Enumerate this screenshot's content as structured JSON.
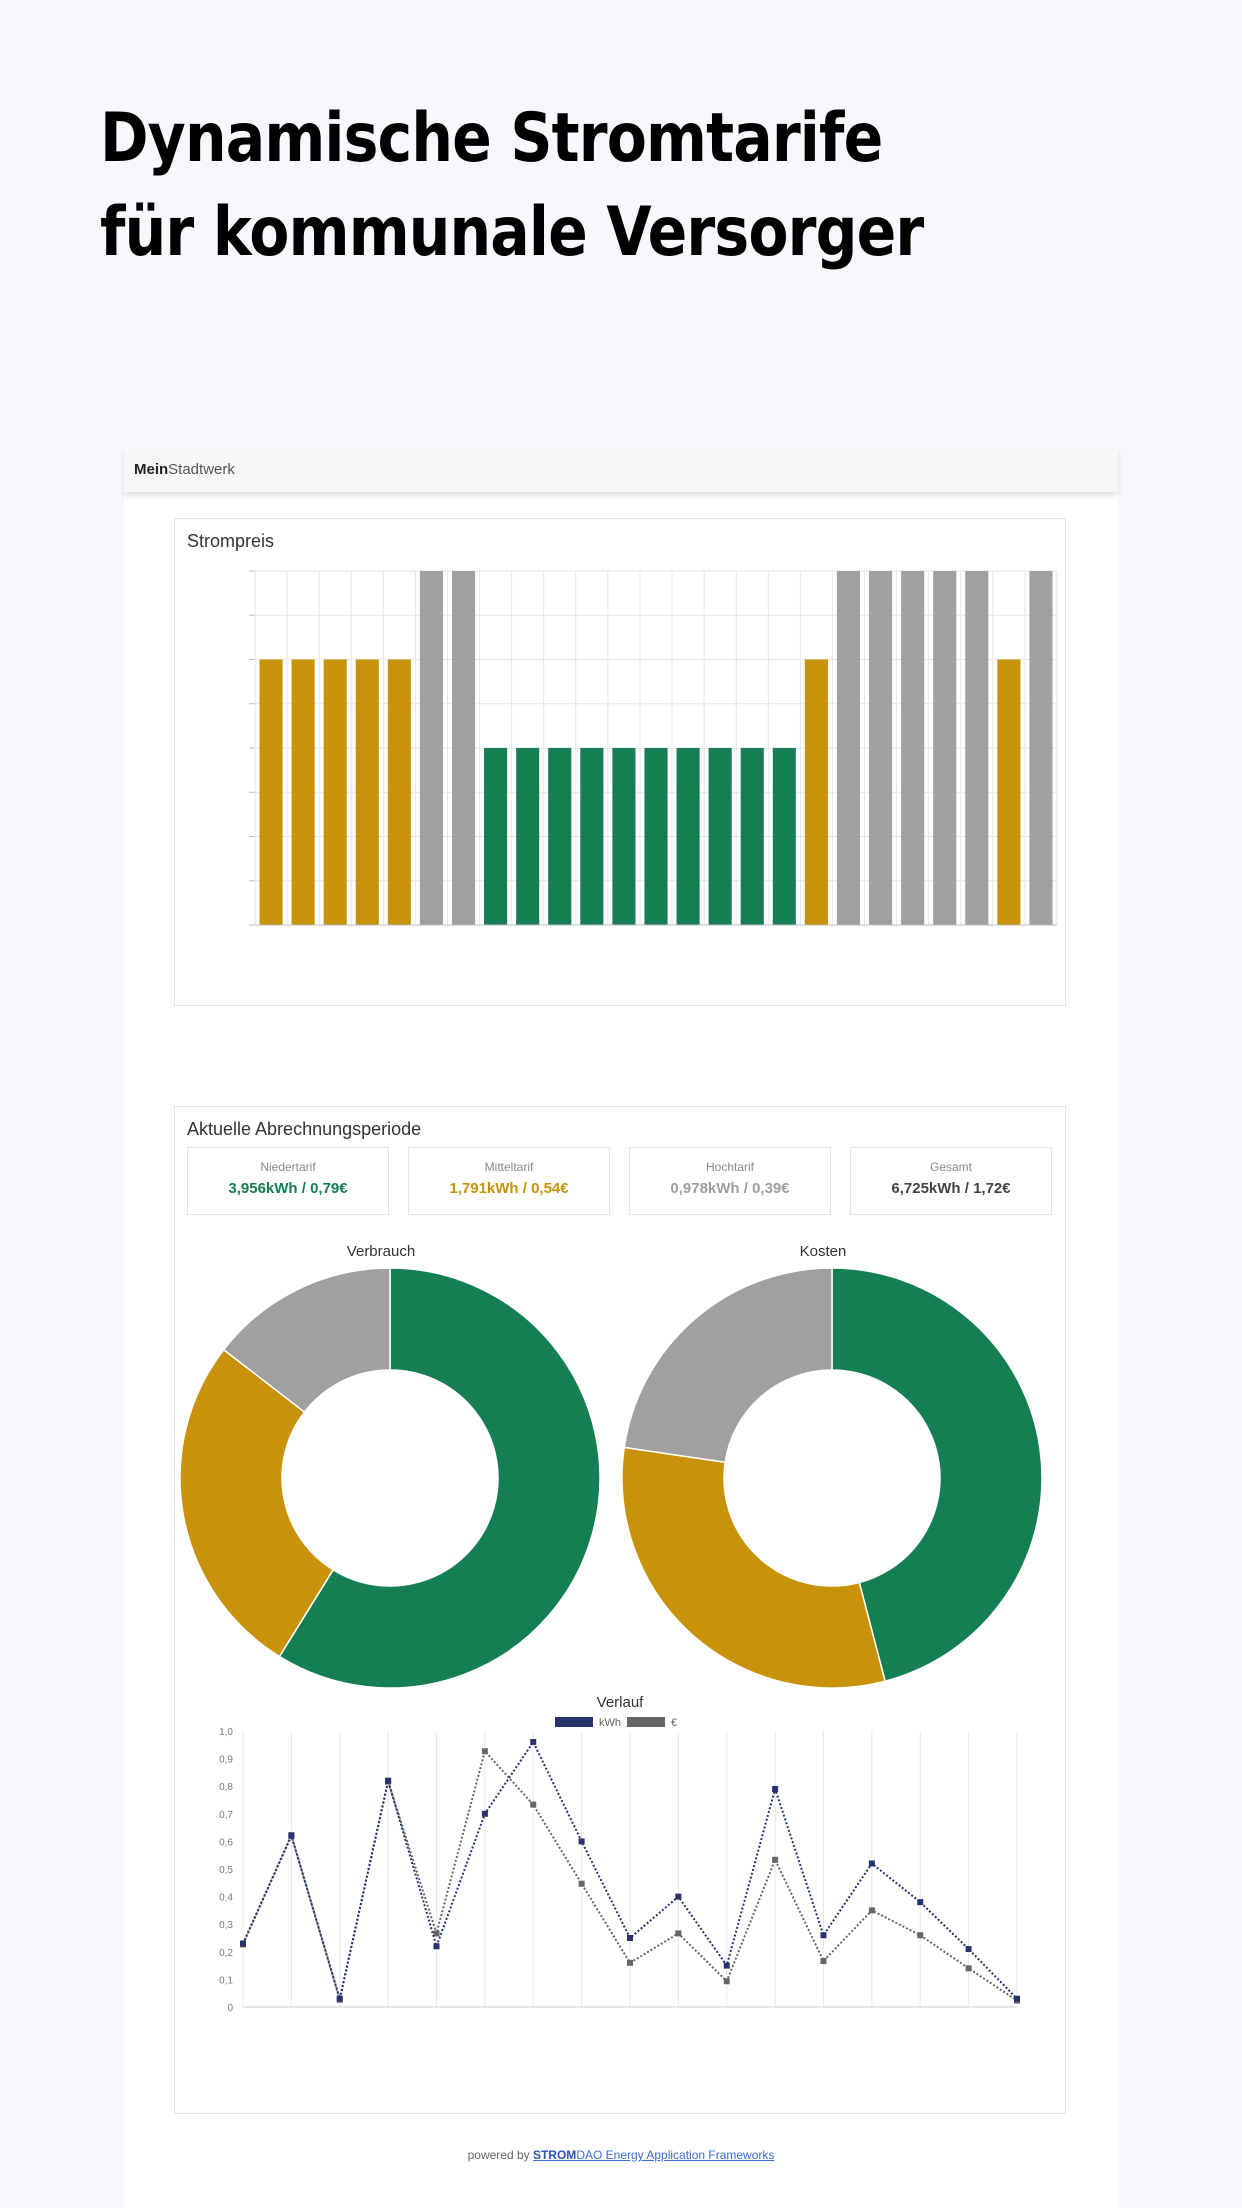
{
  "headline": "Dynamische Stromtarife für kommunale Versorger",
  "app": {
    "brand_bold": "Mein",
    "brand_rest": "Stadtwerk"
  },
  "price_card": {
    "title": "Strompreis"
  },
  "billing_card": {
    "title": "Aktuelle Abrechnungsperiode",
    "stats": [
      {
        "label": "Niedertarif",
        "value": "3,956kWh / 0,79€",
        "color": "#167e53"
      },
      {
        "label": "Mitteltarif",
        "value": "1,791kWh / 0,54€",
        "color": "#c8920a"
      },
      {
        "label": "Hochtarif",
        "value": "0,978kWh / 0,39€",
        "color": "#9e9e9e"
      },
      {
        "label": "Gesamt",
        "value": "6,725kWh / 1,72€",
        "color": "#444444"
      }
    ],
    "donut_consumption_title": "Verbrauch",
    "donut_cost_title": "Kosten",
    "line_title": "Verlauf"
  },
  "footer": {
    "prefix": "powered by ",
    "link_bold": "STROM",
    "link_rest": "DAO Energy Application Frameworks"
  },
  "colors": {
    "low": "#167e53",
    "mid": "#c8920a",
    "high": "#a0a0a0",
    "kwh_line": "#27326e",
    "cost_line": "#666666"
  },
  "chart_data": [
    {
      "type": "bar",
      "title": "Strompreis",
      "ylim": [
        0,
        0.4
      ],
      "series": [
        {
          "values": [
            0.3,
            0.3,
            0.3,
            0.3,
            0.3,
            0.4,
            0.4,
            0.2,
            0.2,
            0.2,
            0.2,
            0.2,
            0.2,
            0.2,
            0.2,
            0.2,
            0.2,
            0.3,
            0.4,
            0.4,
            0.4,
            0.4,
            0.4,
            0.3,
            0.4
          ],
          "tiers": [
            "mid",
            "mid",
            "mid",
            "mid",
            "mid",
            "high",
            "high",
            "low",
            "low",
            "low",
            "low",
            "low",
            "low",
            "low",
            "low",
            "low",
            "low",
            "mid",
            "high",
            "high",
            "high",
            "high",
            "high",
            "mid",
            "high"
          ]
        }
      ],
      "grid": true
    },
    {
      "type": "pie",
      "title": "Verbrauch",
      "categories": [
        "Niedertarif",
        "Mitteltarif",
        "Hochtarif"
      ],
      "values": [
        3.956,
        1.791,
        0.978
      ]
    },
    {
      "type": "pie",
      "title": "Kosten",
      "categories": [
        "Niedertarif",
        "Mitteltarif",
        "Hochtarif"
      ],
      "values": [
        0.79,
        0.54,
        0.39
      ]
    },
    {
      "type": "line",
      "title": "Verlauf",
      "yticks_left": [
        "0",
        "0,1",
        "0,2",
        "0,3",
        "0,4",
        "0,5",
        "0,6",
        "0,7",
        "0,8",
        "0,9",
        "1,0"
      ],
      "ylim_left": [
        0,
        1.0
      ],
      "ylim_right": [
        0,
        0.3
      ],
      "series": [
        {
          "name": "kWh",
          "axis": "left",
          "values": [
            0.23,
            0.62,
            0.03,
            0.82,
            0.22,
            0.7,
            0.96,
            0.6,
            0.25,
            0.4,
            0.15,
            0.79,
            0.26,
            0.52,
            0.38,
            0.21,
            0.03
          ]
        },
        {
          "name": "€",
          "axis": "right",
          "values": [
            0.068,
            0.187,
            0.008,
            0.245,
            0.08,
            0.278,
            0.22,
            0.134,
            0.048,
            0.08,
            0.028,
            0.16,
            0.05,
            0.105,
            0.078,
            0.042,
            0.007
          ]
        }
      ],
      "legend": "top-center",
      "grid": true
    }
  ]
}
